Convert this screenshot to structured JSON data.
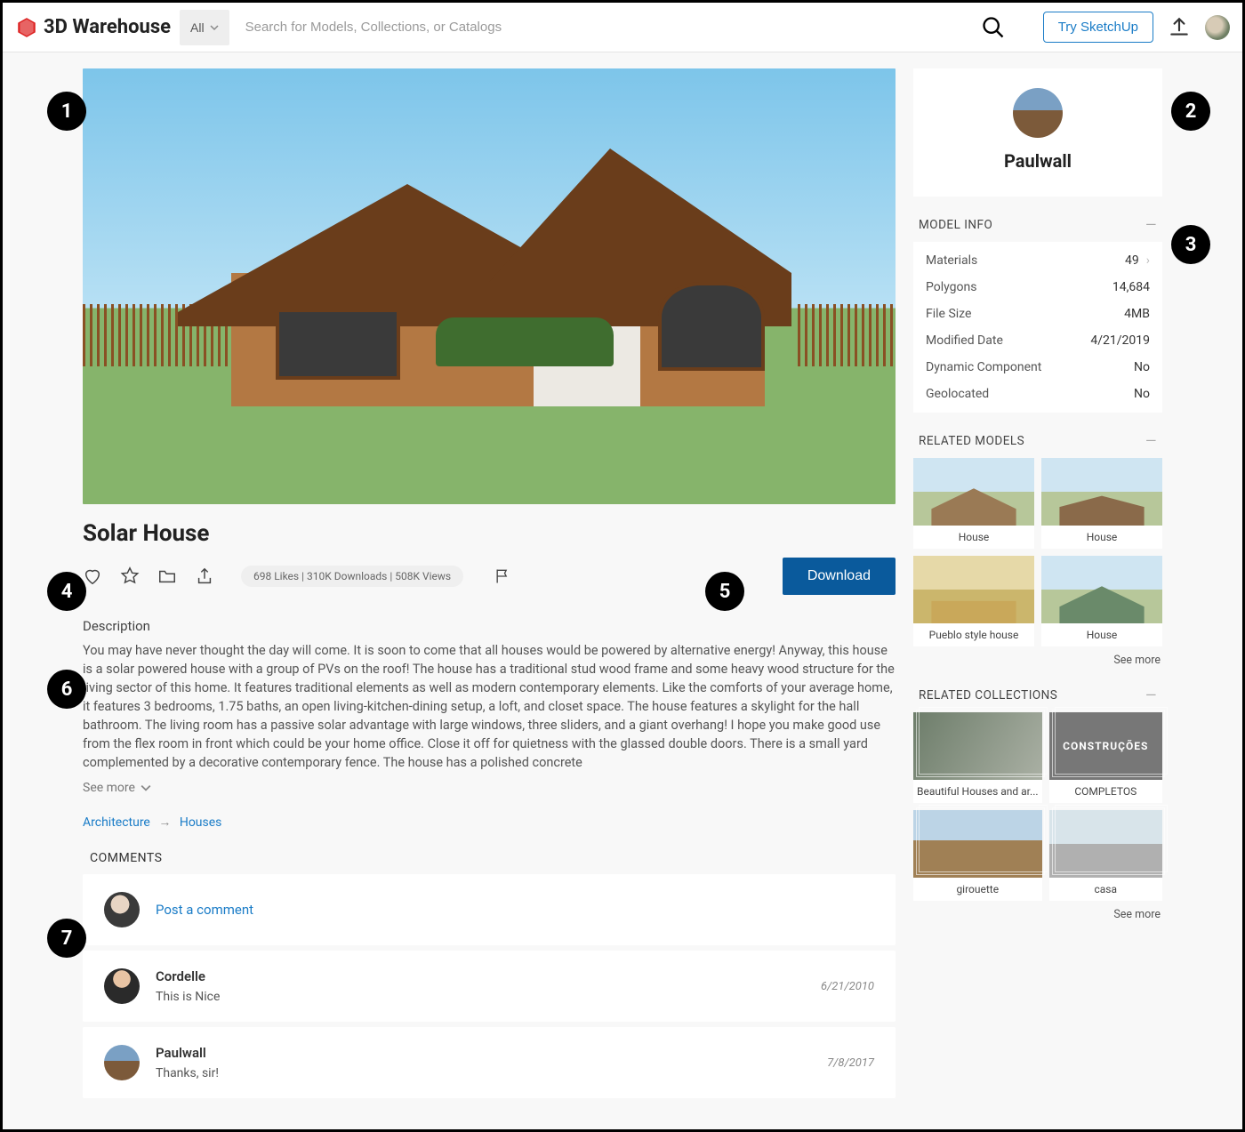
{
  "header": {
    "site_name": "3D Warehouse",
    "filter_label": "All",
    "search_placeholder": "Search for Models, Collections, or Catalogs",
    "try_button": "Try SketchUp"
  },
  "model": {
    "title": "Solar House",
    "stats": "698 Likes  |  310K Downloads  |  508K Views",
    "download_label": "Download",
    "description_label": "Description",
    "description_text": "You may have never thought the day will come. It is soon to come that all houses would be powered by alternative energy! Anyway, this house is a solar powered house with a group of PVs on the roof! The house has a traditional stud wood frame and some heavy wood structure for the living sector of this home. It features traditional elements as well as modern contemporary elements. Like the comforts of your average home, it features 3 bedrooms, 1.75 baths, an open living-kitchen-dining setup, a loft, and closet space. The house features a skylight for the hall bathroom. The living room has a passive solar advantage with large windows, three sliders, and a giant overhang! I hope you make good use from the flex room in front which could be your home office. Close it off for quietness with the glassed double doors. There is a small yard complemented by a decorative contemporary fence. The house has a polished concrete",
    "see_more": "See more",
    "breadcrumb_root": "Architecture",
    "breadcrumb_child": "Houses"
  },
  "author": {
    "name": "Paulwall"
  },
  "model_info": {
    "header": "MODEL INFO",
    "rows": [
      {
        "label": "Materials",
        "value": "49",
        "chevron": true
      },
      {
        "label": "Polygons",
        "value": "14,684"
      },
      {
        "label": "File Size",
        "value": "4MB"
      },
      {
        "label": "Modified Date",
        "value": "4/21/2019"
      },
      {
        "label": "Dynamic Component",
        "value": "No"
      },
      {
        "label": "Geolocated",
        "value": "No"
      }
    ]
  },
  "related_models": {
    "header": "RELATED MODELS",
    "items": [
      "House",
      "House",
      "Pueblo style house",
      "House"
    ],
    "see_more": "See more"
  },
  "related_collections": {
    "header": "RELATED COLLECTIONS",
    "items": [
      "Beautiful Houses and ar...",
      "COMPLETOS",
      "girouette",
      "casa"
    ],
    "overlay_1": "CONSTRUÇÕES",
    "see_more": "See more"
  },
  "comments": {
    "header": "COMMENTS",
    "post_label": "Post a comment",
    "items": [
      {
        "name": "Cordelle",
        "text": "This is Nice",
        "date": "6/21/2010"
      },
      {
        "name": "Paulwall",
        "text": "Thanks, sir!",
        "date": "7/8/2017"
      }
    ]
  },
  "badges": [
    "1",
    "2",
    "3",
    "4",
    "5",
    "6",
    "7"
  ]
}
